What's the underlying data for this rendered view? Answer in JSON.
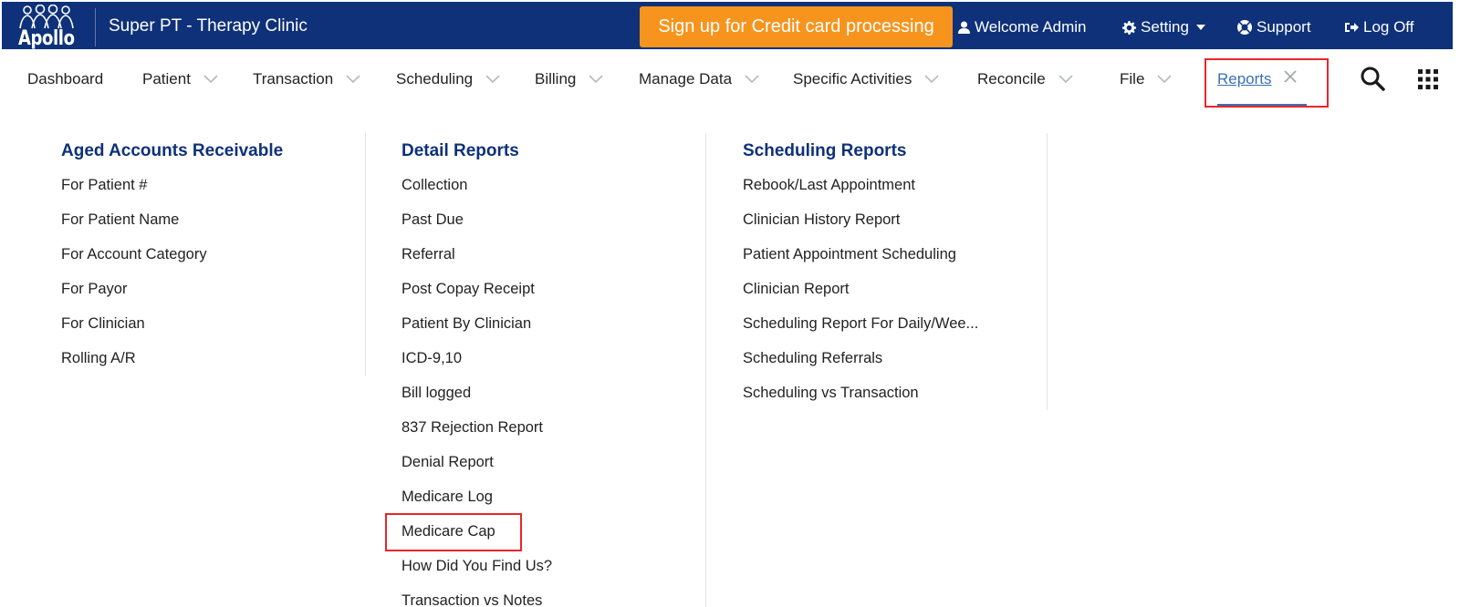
{
  "header": {
    "logo_text": "Apollo",
    "clinic_name": "Super PT - Therapy Clinic",
    "signup_label": "Sign up for Credit card processing",
    "welcome_label": "Welcome Admin",
    "setting_label": "Setting",
    "support_label": "Support",
    "logoff_label": "Log Off"
  },
  "nav": {
    "items": [
      "Dashboard",
      "Patient",
      "Transaction",
      "Scheduling",
      "Billing",
      "Manage Data",
      "Specific Activities",
      "Reconcile",
      "File"
    ],
    "active_label": "Reports"
  },
  "menu": {
    "aged": {
      "heading": "Aged Accounts Receivable",
      "items": [
        "For Patient #",
        "For Patient Name",
        "For Account Category",
        "For Payor",
        "For Clinician",
        "Rolling A/R"
      ]
    },
    "detail": {
      "heading": "Detail Reports",
      "items": [
        "Collection",
        "Past Due",
        "Referral",
        "Post Copay Receipt",
        "Patient By Clinician",
        "ICD-9,10",
        "Bill logged",
        "837 Rejection Report",
        "Denial Report",
        "Medicare Log",
        "Medicare Cap",
        "How Did You Find Us?",
        "Transaction vs Notes"
      ]
    },
    "scheduling": {
      "heading": "Scheduling Reports",
      "items": [
        "Rebook/Last Appointment",
        "Clinician History Report",
        "Patient Appointment Scheduling",
        "Clinician Report",
        "Scheduling Report For Daily/Wee...",
        "Scheduling Referrals",
        "Scheduling vs Transaction"
      ]
    }
  },
  "colors": {
    "header_bg": "#0e3179",
    "signup_bg": "#f7941d",
    "heading": "#0e3179",
    "link_active": "#3a6fb5",
    "highlight": "#e8262b"
  }
}
